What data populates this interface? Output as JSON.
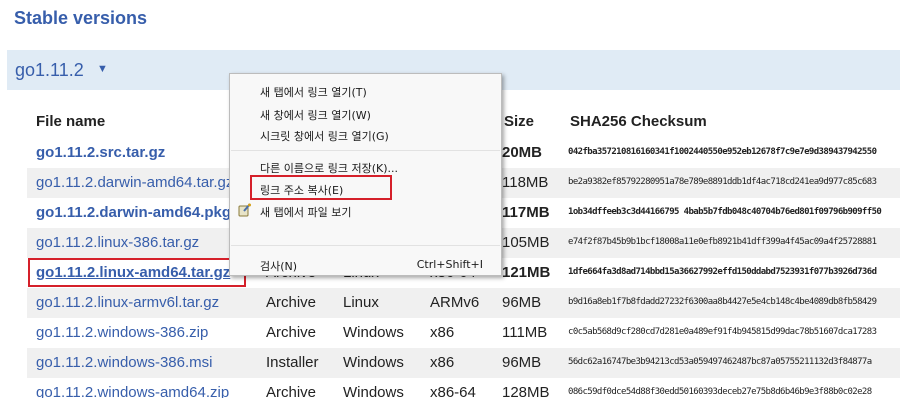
{
  "heading": "Stable versions",
  "version": {
    "label": "go1.11.2",
    "caret": "▼"
  },
  "table": {
    "headers": {
      "file": "File name",
      "size": "Size",
      "sha": "SHA256 Checksum"
    },
    "rows": [
      {
        "name": "go1.11.2.src.tar.gz",
        "kind": "",
        "os": "",
        "arch": "",
        "size": "20MB",
        "sha": "042fba357210816160341f1002440550e952eb12678f7c9e7e9d389437942550"
      },
      {
        "name": "go1.11.2.darwin-amd64.tar.gz",
        "kind": "",
        "os": "",
        "arch": "",
        "size": "118MB",
        "sha": "be2a9382ef85792280951a78e789e8891ddb1df4ac718cd241ea9d977c85c683"
      },
      {
        "name": "go1.11.2.darwin-amd64.pkg",
        "kind": "",
        "os": "",
        "arch": "",
        "size": "117MB",
        "sha": "1ob34dffeeb3c3d44166795 4bab5b7fdb048c40704b76ed801f09796b909ff50"
      },
      {
        "name": "go1.11.2.linux-386.tar.gz",
        "kind": "",
        "os": "",
        "arch": "",
        "size": "105MB",
        "sha": "e74f2f87b45b9b1bcf18008a11e0efb8921b41dff399a4f45ac09a4f25728881"
      },
      {
        "name": "go1.11.2.linux-amd64.tar.gz",
        "kind": "Archive",
        "os": "Linux",
        "arch": "x86-64",
        "size": "121MB",
        "sha": "1dfe664fa3d8ad714bbd15a36627992effd150ddabd7523931f077b3926d736d"
      },
      {
        "name": "go1.11.2.linux-armv6l.tar.gz",
        "kind": "Archive",
        "os": "Linux",
        "arch": "ARMv6",
        "size": "96MB",
        "sha": "b9d16a8eb1f7b8fdadd27232f6300aa8b4427e5e4cb148c4be4089db8fb58429"
      },
      {
        "name": "go1.11.2.windows-386.zip",
        "kind": "Archive",
        "os": "Windows",
        "arch": "x86",
        "size": "111MB",
        "sha": "c0c5ab568d9cf280cd7d281e0a489ef91f4b945815d99dac78b51607dca17283"
      },
      {
        "name": "go1.11.2.windows-386.msi",
        "kind": "Installer",
        "os": "Windows",
        "arch": "x86",
        "size": "96MB",
        "sha": "56dc62a16747be3b94213cd53a059497462487bc87a05755211132d3f84877a"
      },
      {
        "name": "go1.11.2.windows-amd64.zip",
        "kind": "Archive",
        "os": "Windows",
        "arch": "x86-64",
        "size": "128MB",
        "sha": "086c59df0dce54d88f30edd50160393deceb27e75b8d6b46b9e3f88b0c02e28"
      }
    ]
  },
  "context_menu": {
    "items": [
      "새 탭에서 링크 열기(T)",
      "새 창에서 링크 열기(W)",
      "시크릿 창에서 링크 열기(G)",
      "다른 이름으로 링크 저장(K)...",
      "링크 주소 복사(E)",
      "새 탭에서 파일 보기",
      "검사(N)"
    ],
    "inspect_shortcut": "Ctrl+Shift+I",
    "highlight_color": "#d5202a"
  }
}
